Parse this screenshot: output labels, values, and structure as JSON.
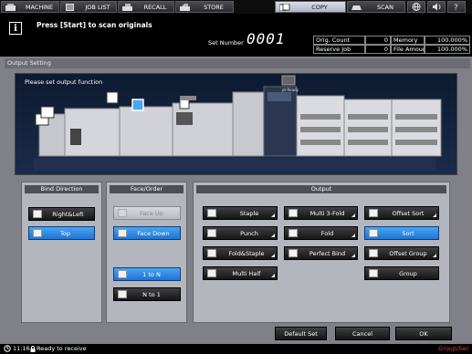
{
  "tabs": [
    {
      "label": "MACHINE",
      "icon": "machine-icon"
    },
    {
      "label": "JOB LIST",
      "icon": "job-list-icon"
    },
    {
      "label": "RECALL",
      "icon": "recall-icon"
    },
    {
      "label": "STORE",
      "icon": "store-icon"
    },
    {
      "label": "COPY",
      "icon": "copy-icon",
      "active": true
    },
    {
      "label": "SCAN",
      "icon": "scan-icon"
    }
  ],
  "header": {
    "message": "Press [Start] to scan originals",
    "set_number_label": "Set Number",
    "set_number_value": "0001"
  },
  "counters": {
    "orig_count_label": "Orig. Count",
    "orig_count_value": "0",
    "memory_label": "Memory",
    "memory_value": "100.000%",
    "reserve_job_label": "Reserve Job",
    "reserve_job_value": "0",
    "file_amount_label": "File Amount",
    "file_amount_value": "100.000%"
  },
  "panel": {
    "title": "Output Setting",
    "machine_message": "Please set output function",
    "machine_label": "pt-Ready"
  },
  "bind_direction": {
    "title": "Bind Direction",
    "options": [
      {
        "label": "Right&Left",
        "selected": false
      },
      {
        "label": "Top",
        "selected": true
      }
    ]
  },
  "face_order": {
    "title": "Face/Order",
    "face_up": "Face Up",
    "face_down": "Face Down",
    "one_to_n": "1 to N",
    "n_to_one": "N to 1"
  },
  "output": {
    "title": "Output",
    "staple": "Staple",
    "punch": "Punch",
    "fold_staple": "Fold&Staple",
    "multi_half": "Multi Half",
    "multi_3fold": "Multi 3-Fold",
    "fold": "Fold",
    "perfect_bind": "Perfect Bind",
    "offset_sort": "Offset Sort",
    "sort": "Sort",
    "offset_group": "Offset Group",
    "group": "Group"
  },
  "buttons": {
    "default_set": "Default Set",
    "cancel": "Cancel",
    "ok": "OK"
  },
  "status": {
    "time": "11:16",
    "text": "Ready to receive",
    "right": "Group/Sec"
  },
  "colors": {
    "selected_blue": "#1e74d6",
    "panel_gray": "#b4b6bd",
    "dark_button": "#151517"
  }
}
